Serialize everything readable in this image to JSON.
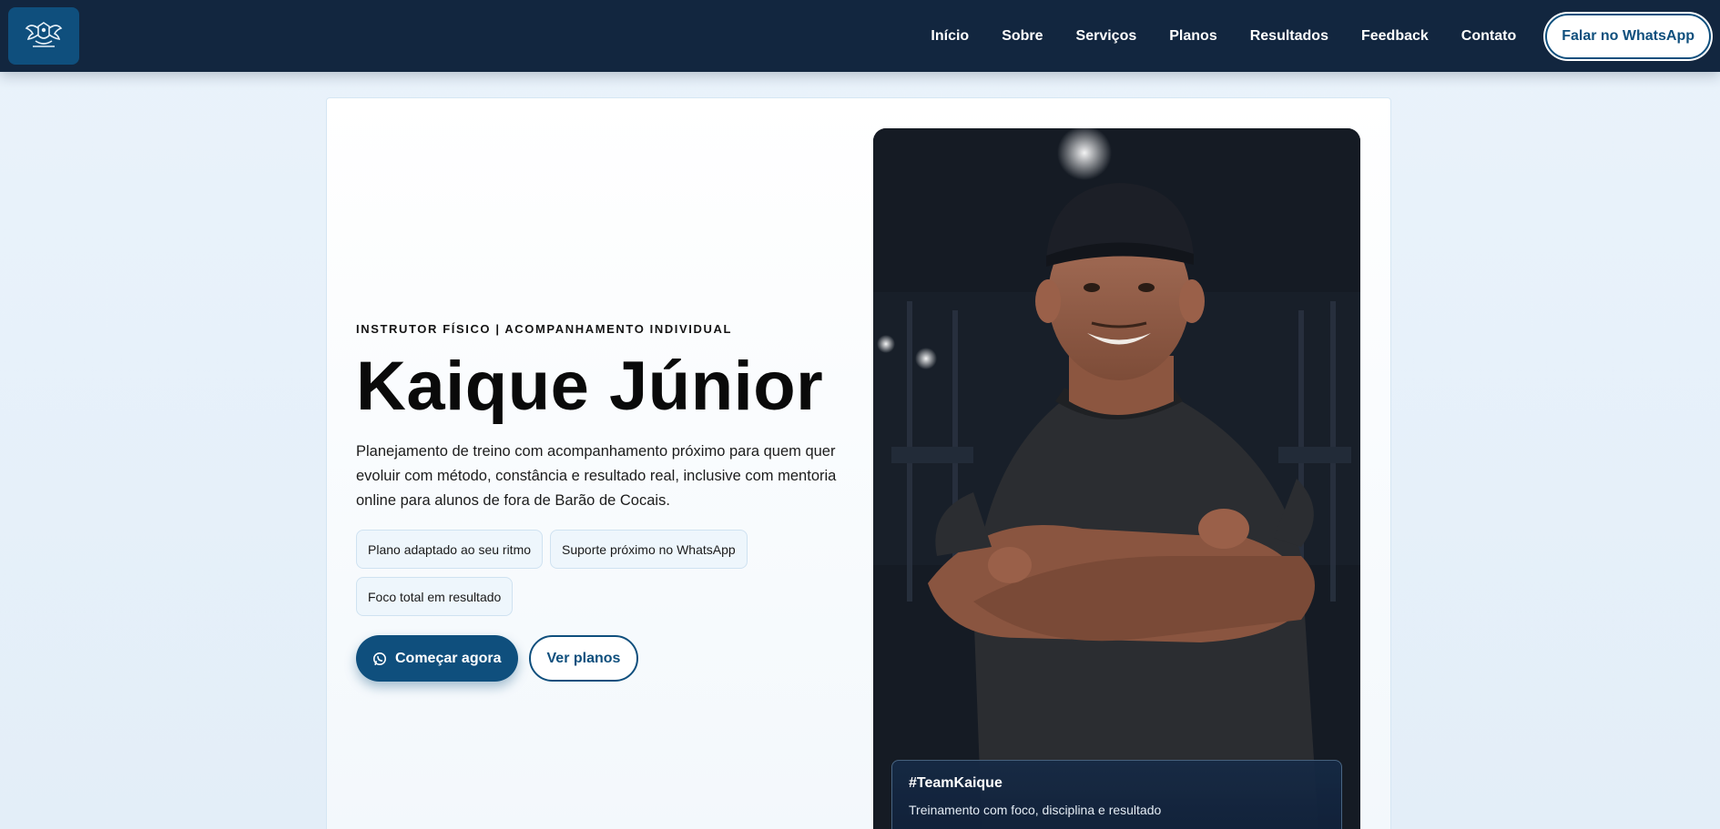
{
  "nav": {
    "logo_alt": "Kaique Júnior logo",
    "links": [
      "Início",
      "Sobre",
      "Serviços",
      "Planos",
      "Resultados",
      "Feedback",
      "Contato"
    ],
    "cta": "Falar no WhatsApp"
  },
  "hero": {
    "eyebrow": "INSTRUTOR FÍSICO | ACOMPANHAMENTO INDIVIDUAL",
    "title": "Kaique Júnior",
    "description": "Planejamento de treino com acompanhamento próximo para quem quer evoluir com método, constância e resultado real, inclusive com mentoria online para alunos de fora de Barão de Cocais.",
    "tags": [
      "Plano adaptado ao seu ritmo",
      "Suporte próximo no WhatsApp",
      "Foco total em resultado"
    ],
    "primary_button": "Começar agora",
    "secondary_button": "Ver planos"
  },
  "photo": {
    "caption_title": "#TeamKaique",
    "caption_text": "Treinamento com foco, disciplina e resultado"
  },
  "colors": {
    "navbar": "#12263f",
    "accent": "#0f4f7d",
    "page_bg": "#eaf3fb"
  },
  "icons": {
    "logo": "crest-logo-icon",
    "primary_button": "whatsapp-icon"
  }
}
